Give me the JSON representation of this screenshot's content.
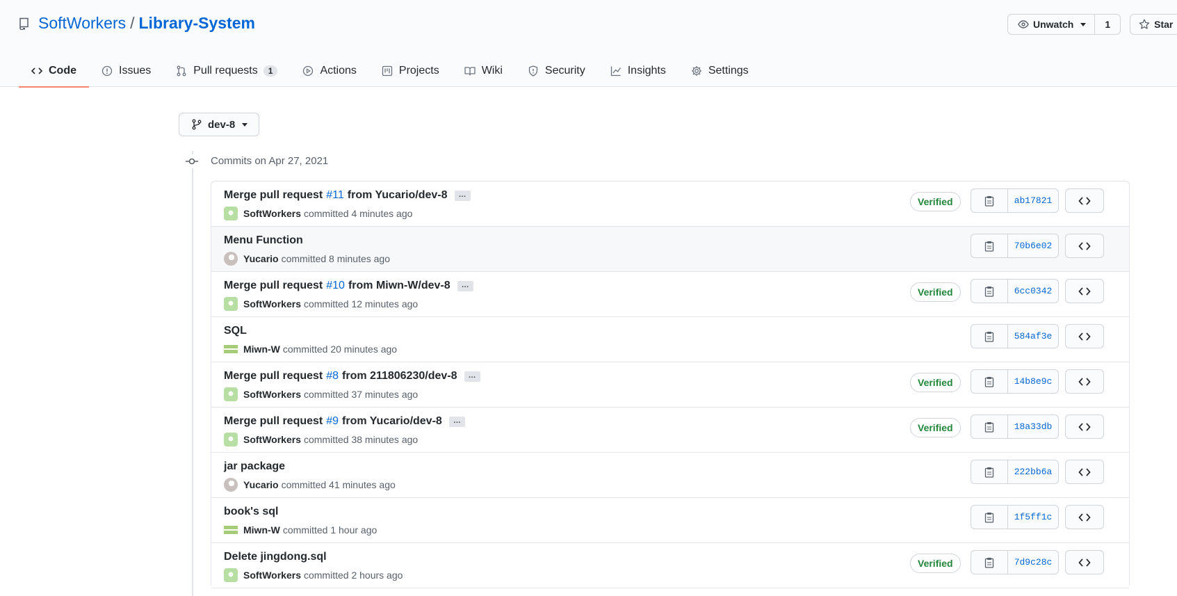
{
  "repo": {
    "owner": "SoftWorkers",
    "separator": "/",
    "name": "Library-System"
  },
  "header_actions": {
    "watch_label": "Unwatch",
    "watch_count": "1",
    "star_label": "Star"
  },
  "tabs": [
    {
      "label": "Code",
      "icon": "code-icon",
      "active": true
    },
    {
      "label": "Issues",
      "icon": "issue-icon"
    },
    {
      "label": "Pull requests",
      "icon": "pull-request-icon",
      "count": "1"
    },
    {
      "label": "Actions",
      "icon": "play-icon"
    },
    {
      "label": "Projects",
      "icon": "project-icon"
    },
    {
      "label": "Wiki",
      "icon": "book-icon"
    },
    {
      "label": "Security",
      "icon": "shield-icon"
    },
    {
      "label": "Insights",
      "icon": "graph-icon"
    },
    {
      "label": "Settings",
      "icon": "gear-icon"
    }
  ],
  "branch": {
    "label": "dev-8"
  },
  "commits_date": "Commits on Apr 27, 2021",
  "commits": [
    {
      "pre": "Merge pull request",
      "pr": "#11",
      "post": "from Yucario/dev-8",
      "ellipsis": true,
      "author": "SoftWorkers",
      "avatar": "soft",
      "time": "committed 4 minutes ago",
      "verified": true,
      "sha": "ab17821"
    },
    {
      "pre": "Menu Function",
      "author": "Yucario",
      "avatar": "yuc",
      "time": "committed 8 minutes ago",
      "verified": false,
      "sha": "70b6e02",
      "hover": true
    },
    {
      "pre": "Merge pull request",
      "pr": "#10",
      "post": "from Miwn-W/dev-8",
      "ellipsis": true,
      "author": "SoftWorkers",
      "avatar": "soft",
      "time": "committed 12 minutes ago",
      "verified": true,
      "sha": "6cc0342"
    },
    {
      "pre": "SQL",
      "author": "Miwn-W",
      "avatar": "miwn",
      "time": "committed 20 minutes ago",
      "verified": false,
      "sha": "584af3e"
    },
    {
      "pre": "Merge pull request",
      "pr": "#8",
      "post": "from 211806230/dev-8",
      "ellipsis": true,
      "author": "SoftWorkers",
      "avatar": "soft",
      "time": "committed 37 minutes ago",
      "verified": true,
      "sha": "14b8e9c"
    },
    {
      "pre": "Merge pull request",
      "pr": "#9",
      "post": "from Yucario/dev-8",
      "ellipsis": true,
      "author": "SoftWorkers",
      "avatar": "soft",
      "time": "committed 38 minutes ago",
      "verified": true,
      "sha": "18a33db"
    },
    {
      "pre": "jar package",
      "author": "Yucario",
      "avatar": "yuc",
      "time": "committed 41 minutes ago",
      "verified": false,
      "sha": "222bb6a"
    },
    {
      "pre": "book's sql",
      "author": "Miwn-W",
      "avatar": "miwn",
      "time": "committed 1 hour ago",
      "verified": false,
      "sha": "1f5ff1c"
    },
    {
      "pre": "Delete jingdong.sql",
      "author": "SoftWorkers",
      "avatar": "soft",
      "time": "committed 2 hours ago",
      "verified": true,
      "sha": "7d9c28c"
    }
  ],
  "labels": {
    "verified": "Verified",
    "ellipsis": "…"
  }
}
